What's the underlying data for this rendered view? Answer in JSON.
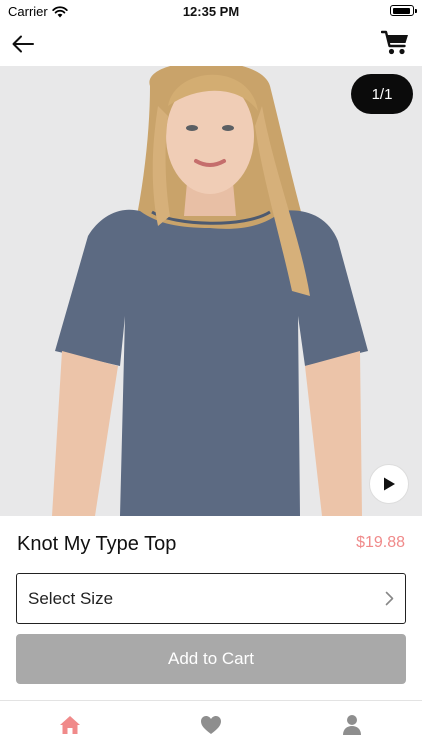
{
  "status_bar": {
    "carrier": "Carrier",
    "time": "12:35 PM",
    "battery_level": 0.95
  },
  "nav": {
    "back_icon": "arrow-left-icon",
    "cart_icon": "shopping-cart-icon"
  },
  "gallery": {
    "counter": "1/1",
    "video_icon": "play-icon"
  },
  "product": {
    "name": "Knot My Type Top",
    "price": "$19.88"
  },
  "size_select": {
    "label": "Select Size",
    "chevron_icon": "chevron-right-icon"
  },
  "add_to_cart": {
    "label": "Add to Cart"
  },
  "tab_bar": {
    "tabs": [
      {
        "icon": "home-icon",
        "active": true
      },
      {
        "icon": "heart-icon",
        "active": false
      },
      {
        "icon": "user-icon",
        "active": false
      }
    ]
  },
  "colors": {
    "accent": "#f08a8a",
    "button_disabled": "#a9a9a9",
    "tab_inactive": "#8e8e8e"
  }
}
